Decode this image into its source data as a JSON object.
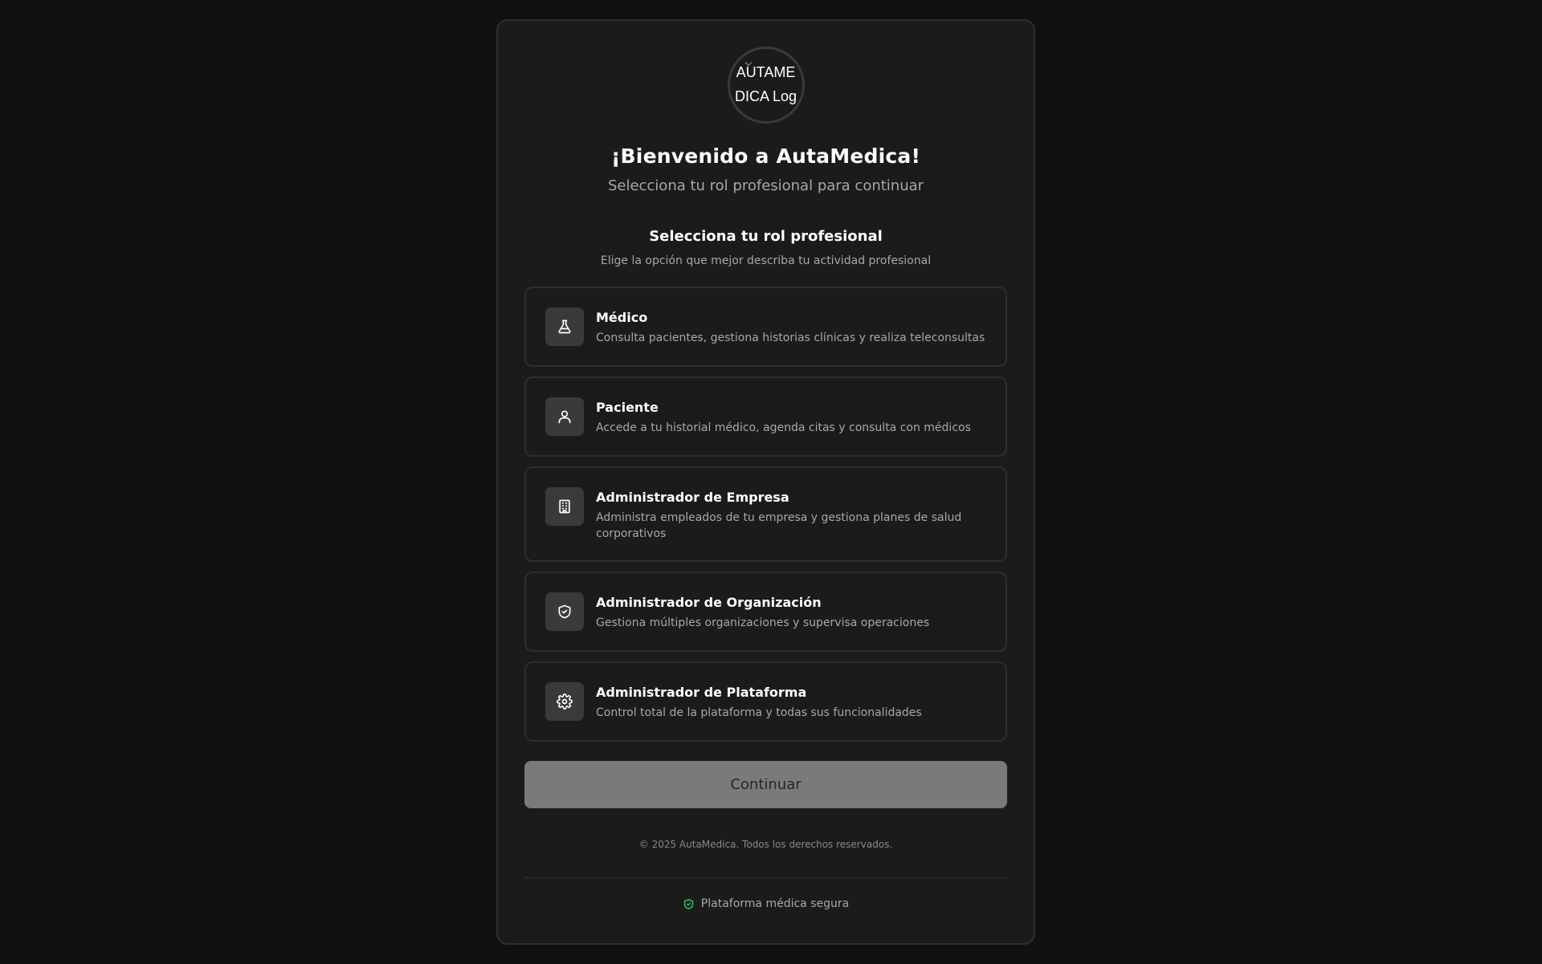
{
  "logo": {
    "alt_text": "AUTAMEDICA Logo"
  },
  "header": {
    "title": "¡Bienvenido a AutaMedica!",
    "subtitle": "Selecciona tu rol profesional para continuar"
  },
  "role_section": {
    "title": "Selecciona tu rol profesional",
    "subtitle": "Elige la opción que mejor describa tu actividad profesional"
  },
  "roles": [
    {
      "name": "Médico",
      "description": "Consulta pacientes, gestiona historias clínicas y realiza teleconsultas",
      "icon": "flask-icon"
    },
    {
      "name": "Paciente",
      "description": "Accede a tu historial médico, agenda citas y consulta con médicos",
      "icon": "user-icon"
    },
    {
      "name": "Administrador de Empresa",
      "description": "Administra empleados de tu empresa y gestiona planes de salud corporativos",
      "icon": "building-icon"
    },
    {
      "name": "Administrador de Organización",
      "description": "Gestiona múltiples organizaciones y supervisa operaciones",
      "icon": "shield-check-icon"
    },
    {
      "name": "Administrador de Plataforma",
      "description": "Control total de la plataforma y todas sus funcionalidades",
      "icon": "gear-icon"
    }
  ],
  "continue_label": "Continuar",
  "footer": {
    "copyright": "© 2025 AutaMedica. Todos los derechos reservados.",
    "secure_label": "Plataforma médica segura",
    "secure_icon": "shield-check-icon",
    "secure_icon_color": "#22c55e"
  },
  "colors": {
    "background": "#111111",
    "card": "#1b1b1b",
    "button_disabled": "#7a7a7a"
  }
}
